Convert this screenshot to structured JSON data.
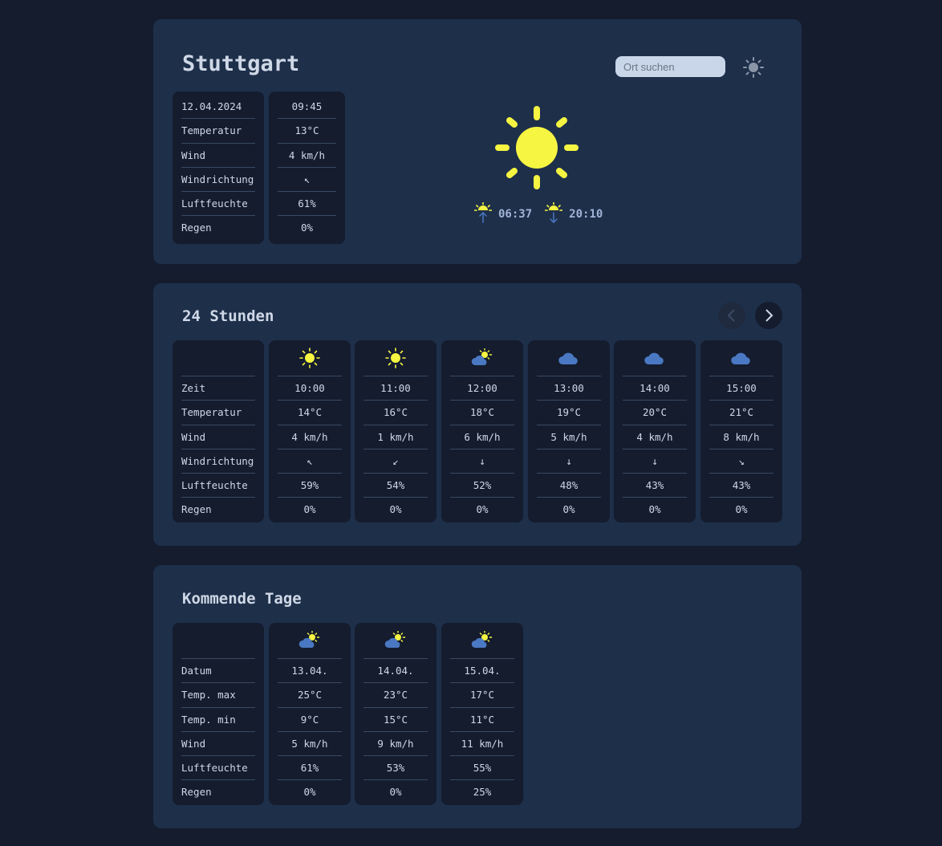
{
  "current": {
    "city": "Stuttgart",
    "search_placeholder": "Ort suchen",
    "labels": [
      "12.04.2024",
      "Temperatur",
      "Wind",
      "Windrichtung",
      "Luftfeuchte",
      "Regen"
    ],
    "values": [
      "09:45",
      "13°C",
      "4 km/h",
      "↖",
      "61%",
      "0%"
    ],
    "sunrise": "06:37",
    "sunset": "20:10",
    "icon": "sun-icon"
  },
  "hourly": {
    "title": "24 Stunden",
    "labels": [
      "Zeit",
      "Temperatur",
      "Wind",
      "Windrichtung",
      "Luftfeuchte",
      "Regen"
    ],
    "columns": [
      {
        "icon": "sun",
        "time": "10:00",
        "temp": "14°C",
        "wind": "4 km/h",
        "dir": "↖",
        "hum": "59%",
        "rain": "0%"
      },
      {
        "icon": "sun",
        "time": "11:00",
        "temp": "16°C",
        "wind": "1 km/h",
        "dir": "↙",
        "hum": "54%",
        "rain": "0%"
      },
      {
        "icon": "partly-cloudy",
        "time": "12:00",
        "temp": "18°C",
        "wind": "6 km/h",
        "dir": "↓",
        "hum": "52%",
        "rain": "0%"
      },
      {
        "icon": "cloud",
        "time": "13:00",
        "temp": "19°C",
        "wind": "5 km/h",
        "dir": "↓",
        "hum": "48%",
        "rain": "0%"
      },
      {
        "icon": "cloud",
        "time": "14:00",
        "temp": "20°C",
        "wind": "4 km/h",
        "dir": "↓",
        "hum": "43%",
        "rain": "0%"
      },
      {
        "icon": "cloud",
        "time": "15:00",
        "temp": "21°C",
        "wind": "8 km/h",
        "dir": "↘",
        "hum": "43%",
        "rain": "0%"
      }
    ]
  },
  "daily": {
    "title": "Kommende Tage",
    "labels": [
      "Datum",
      "Temp. max",
      "Temp. min",
      "Wind",
      "Luftfeuchte",
      "Regen"
    ],
    "columns": [
      {
        "icon": "partly-cloudy",
        "date": "13.04.",
        "max": "25°C",
        "min": "9°C",
        "wind": "5 km/h",
        "hum": "61%",
        "rain": "0%"
      },
      {
        "icon": "partly-cloudy",
        "date": "14.04.",
        "max": "23°C",
        "min": "15°C",
        "wind": "9 km/h",
        "hum": "53%",
        "rain": "0%"
      },
      {
        "icon": "partly-cloudy",
        "date": "15.04.",
        "max": "17°C",
        "min": "11°C",
        "wind": "11 km/h",
        "hum": "55%",
        "rain": "25%"
      }
    ]
  },
  "colors": {
    "background": "#141c2e",
    "panel": "#1e2f4a",
    "sun": "#f5f542",
    "cloud": "#4a78c2",
    "text": "#cfd8e6"
  }
}
